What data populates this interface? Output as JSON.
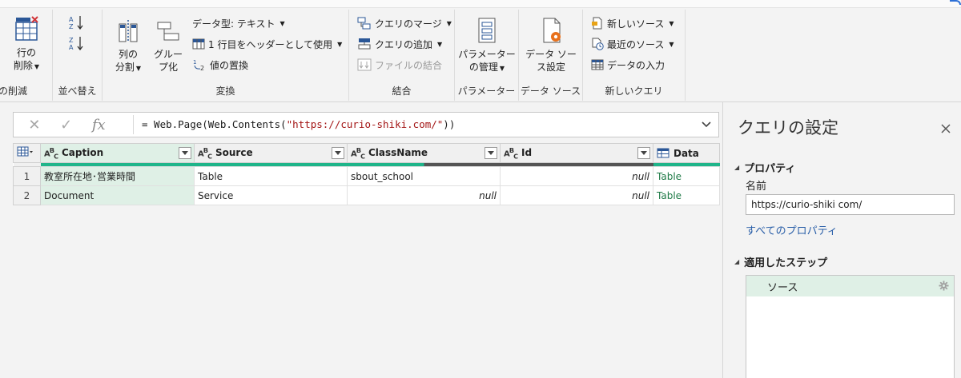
{
  "ribbon": {
    "reduce_rows": {
      "remove_rows_line1": "行の",
      "remove_rows_line2": "削除",
      "group_label": "の削減"
    },
    "sort": {
      "group_label": "並べ替え"
    },
    "transform": {
      "split_column_line1": "列の",
      "split_column_line2": "分割",
      "group_by_line1": "グルー",
      "group_by_line2": "プ化",
      "data_type": "データ型: テキスト",
      "use_first_row": "1 行目をヘッダーとして使用",
      "replace_values": "値の置換",
      "group_label": "変換"
    },
    "combine": {
      "merge_queries": "クエリのマージ",
      "append_queries": "クエリの追加",
      "combine_files": "ファイルの結合",
      "group_label": "結合"
    },
    "parameters": {
      "manage_line1": "パラメーター",
      "manage_line2": "の管理",
      "group_label": "パラメーター"
    },
    "data_sources": {
      "settings_line1": "データ ソー",
      "settings_line2": "ス設定",
      "group_label": "データ ソース"
    },
    "new_query": {
      "new_source": "新しいソース",
      "recent_sources": "最近のソース",
      "enter_data": "データの入力",
      "group_label": "新しいクエリ"
    }
  },
  "formula_bar": {
    "prefix": "= Web.Page(Web.Contents(",
    "url_string": "\"https://curio-shiki.com/\"",
    "suffix": "))"
  },
  "grid": {
    "columns": [
      {
        "name": "Caption",
        "type": "ABC",
        "quality": "full"
      },
      {
        "name": "Source",
        "type": "ABC",
        "quality": "full"
      },
      {
        "name": "ClassName",
        "type": "ABC",
        "quality": "partial"
      },
      {
        "name": "Id",
        "type": "ABC",
        "quality": "empty"
      },
      {
        "name": "Data",
        "type": "table",
        "quality": "full"
      }
    ],
    "rows": [
      {
        "num": "1",
        "caption": "教室所在地･営業時間",
        "source": "Table",
        "classname": "sbout_school",
        "id": "null",
        "data": "Table"
      },
      {
        "num": "2",
        "caption": "Document",
        "source": "Service",
        "classname": "null",
        "id": "null",
        "data": "Table"
      }
    ]
  },
  "query_settings": {
    "title": "クエリの設定",
    "properties_header": "プロパティ",
    "name_label": "名前",
    "name_value": "https://curio-shiki com/",
    "all_properties_link": "すべてのプロパティ",
    "applied_steps_header": "適用したステップ",
    "steps": [
      {
        "label": "ソース"
      }
    ]
  },
  "colors": {
    "quality_full": "#1fb58a",
    "quality_error": "#555555",
    "selected_column": "#dff0e6",
    "link_green": "#1e7a46",
    "link_blue": "#2a5fa8"
  }
}
